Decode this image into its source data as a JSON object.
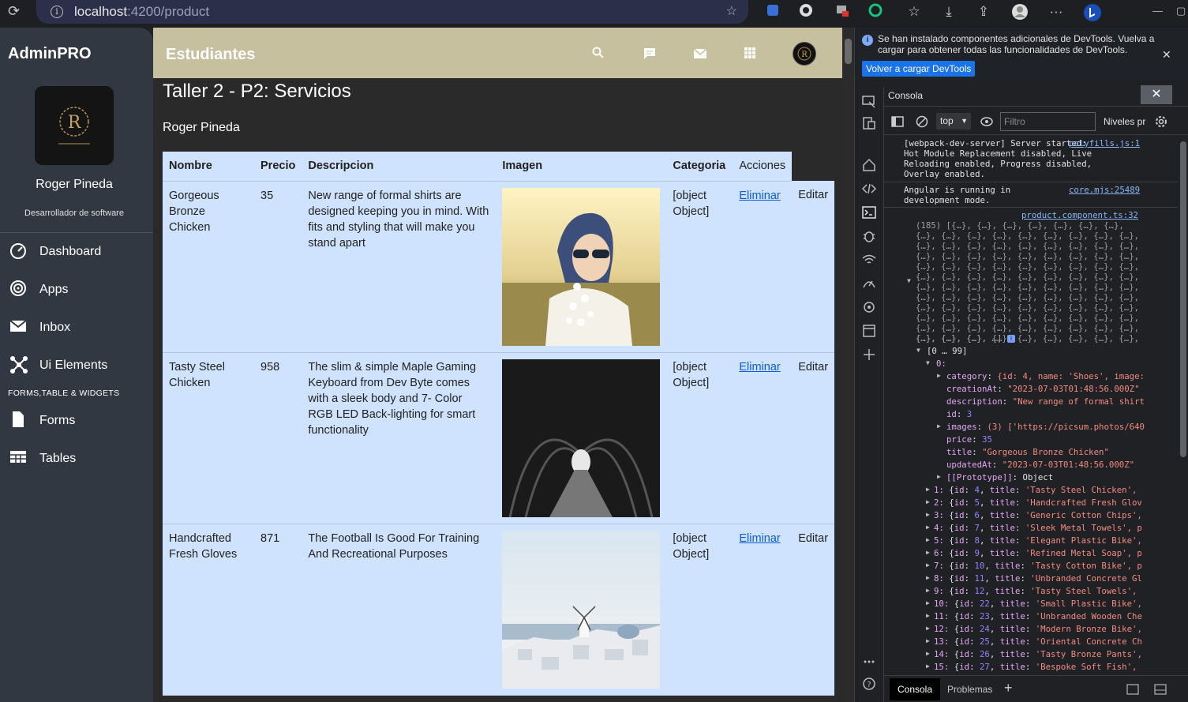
{
  "browser": {
    "url_host": "localhost",
    "url_path": ":4200/product"
  },
  "sidebar": {
    "brand": "AdminPRO",
    "user_name": "Roger Pineda",
    "user_role": "Desarrollador de software",
    "nav": [
      {
        "label": "Dashboard",
        "icon": "speedometer-icon"
      },
      {
        "label": "Apps",
        "icon": "target-icon"
      },
      {
        "label": "Inbox",
        "icon": "mail-icon"
      },
      {
        "label": "Ui Elements",
        "icon": "molecule-icon"
      }
    ],
    "section_title": "FORMS,TABLE & WIDGETS",
    "nav2": [
      {
        "label": "Forms",
        "icon": "file-icon"
      },
      {
        "label": "Tables",
        "icon": "table-icon"
      }
    ]
  },
  "topbar": {
    "title": "Estudiantes",
    "icons": [
      "search-icon",
      "message-icon",
      "mail-icon",
      "apps-grid-icon"
    ]
  },
  "main": {
    "heading": "Taller 2 - P2: Servicios",
    "author": "Roger Pineda",
    "columns": [
      "Nombre",
      "Precio",
      "Descripcion",
      "Imagen",
      "Categoria",
      "Acciones"
    ],
    "rows": [
      {
        "name": "Gorgeous Bronze Chicken",
        "price": "35",
        "description": "New range of formal shirts are designed keeping you in mind. With fits and styling that will make you stand apart",
        "image": "girl-sunglasses-flowers",
        "category": "[object Object]",
        "delete": "Eliminar",
        "edit": "Editar"
      },
      {
        "name": "Tasty Steel Chicken",
        "price": "958",
        "description": "The slim & simple Maple Gaming Keyboard from Dev Byte comes with a sleek body and 7- Color RGB LED Back-lighting for smart functionality",
        "image": "tree-tunnel-road",
        "category": "[object Object]",
        "delete": "Eliminar",
        "edit": "Editar"
      },
      {
        "name": "Handcrafted Fresh Gloves",
        "price": "871",
        "description": "The Football Is Good For Training And Recreational Purposes",
        "image": "santorini-windmill",
        "category": "[object Object]",
        "delete": "Eliminar",
        "edit": "Editar"
      }
    ]
  },
  "devtools": {
    "notice_text": "Se han instalado componentes adicionales de DevTools. Vuelva a cargar para obtener todas las funcionalidades de DevTools.",
    "notice_button": "Volver a cargar DevTools",
    "panel_title": "Consola",
    "context": "top",
    "filter_placeholder": "Filtro",
    "levels": "Niveles pr",
    "msg1": "[webpack-dev-server] Server started: Hot Module Replacement disabled, Live Reloading enabled, Progress disabled, Overlay enabled.",
    "msg1_src": "polyfills.js:1",
    "msg2": "Angular is running in development mode.",
    "msg2_src": "core.mjs:25489",
    "msg3_src": "product.component.ts:32",
    "array_preview_first": "(185) [{…}, {…}, {…}, {…}, {…}, {…}, {…},",
    "array_preview_line": "{…}, {…}, {…}, {…}, {…}, {…}, {…}, {…}, {…},",
    "array_preview_last": "{…}, {…}, {…}, …]",
    "range": "[0 … 99]",
    "obj0_index": "0:",
    "obj0_props": [
      {
        "key": "category",
        "value": "{id: 4, name: 'Shoes', image:",
        "expandable": true
      },
      {
        "key": "creationAt",
        "value": "\"2023-07-03T01:48:56.000Z\"",
        "expandable": false
      },
      {
        "key": "description",
        "value": "\"New range of formal shirt",
        "expandable": false
      },
      {
        "key": "id",
        "value": "3",
        "expandable": false
      },
      {
        "key": "images",
        "value": "(3) ['https://picsum.photos/640",
        "expandable": true
      },
      {
        "key": "price",
        "value": "35",
        "expandable": false
      },
      {
        "key": "title",
        "value": "\"Gorgeous Bronze Chicken\"",
        "expandable": false
      },
      {
        "key": "updatedAt",
        "value": "\"2023-07-03T01:48:56.000Z\"",
        "expandable": false
      },
      {
        "key": "[[Prototype]]",
        "value": "Object",
        "expandable": true
      }
    ],
    "items": [
      {
        "idx": "1:",
        "id": "4",
        "title": "'Tasty Steel Chicken',"
      },
      {
        "idx": "2:",
        "id": "5",
        "title": "'Handcrafted Fresh Glov"
      },
      {
        "idx": "3:",
        "id": "6",
        "title": "'Generic Cotton Chips',"
      },
      {
        "idx": "4:",
        "id": "7",
        "title": "'Sleek Metal Towels', p"
      },
      {
        "idx": "5:",
        "id": "8",
        "title": "'Elegant Plastic Bike',"
      },
      {
        "idx": "6:",
        "id": "9",
        "title": "'Refined Metal Soap', p"
      },
      {
        "idx": "7:",
        "id": "10",
        "title": "'Tasty Cotton Bike', p"
      },
      {
        "idx": "8:",
        "id": "11",
        "title": "'Unbranded Concrete Gl"
      },
      {
        "idx": "9:",
        "id": "12",
        "title": "'Tasty Steel Towels',"
      },
      {
        "idx": "10:",
        "id": "22",
        "title": "'Small Plastic Bike',"
      },
      {
        "idx": "11:",
        "id": "23",
        "title": "'Unbranded Wooden Che"
      },
      {
        "idx": "12:",
        "id": "24",
        "title": "'Modern Bronze Bike',"
      },
      {
        "idx": "13:",
        "id": "25",
        "title": "'Oriental Concrete Ch"
      },
      {
        "idx": "14:",
        "id": "26",
        "title": "'Tasty Bronze Pants',"
      },
      {
        "idx": "15:",
        "id": "27",
        "title": "'Bespoke Soft Fish',"
      }
    ],
    "bottom_tab1": "Consola",
    "bottom_tab2": "Problemas"
  }
}
